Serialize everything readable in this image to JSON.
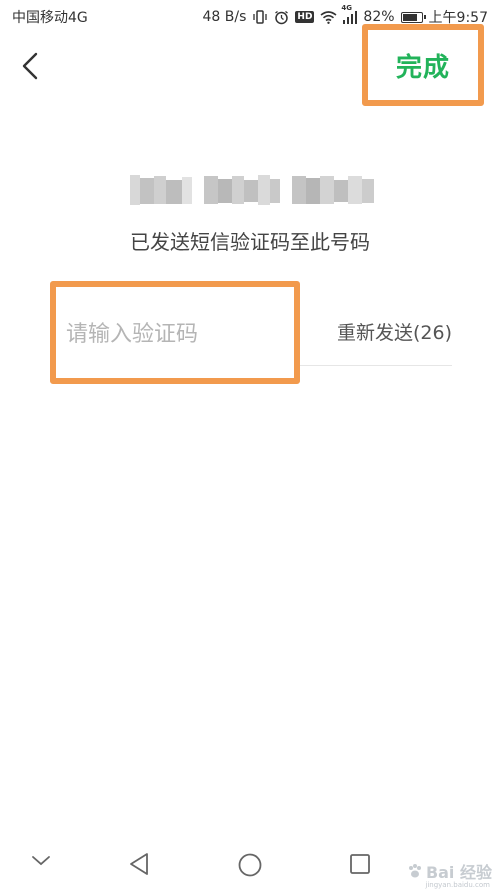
{
  "status_bar": {
    "carrier": "中国移动4G",
    "net_speed": "48 B/s",
    "battery_percent": "82%",
    "time": "上午9:57",
    "signal_label": "4G",
    "hd_label": "HD",
    "battery_level": 0.82,
    "icons": [
      "vibrate-icon",
      "alarm-icon",
      "hd-icon",
      "wifi-icon",
      "signal-icon",
      "battery-icon"
    ]
  },
  "header": {
    "back_icon": "chevron-left-icon",
    "done_label": "完成"
  },
  "verification": {
    "sent_hint": "已发送短信验证码至此号码",
    "code_placeholder": "请输入验证码",
    "code_value": "",
    "resend_label": "重新发送(26)"
  },
  "nav_bar": {
    "icons": [
      "chevron-down-icon",
      "back-triangle-icon",
      "home-circle-icon",
      "recents-square-icon"
    ]
  },
  "watermark": {
    "text": "Bai 经验",
    "sub": "jingyan.baidu.com"
  },
  "colors": {
    "accent_green": "#22b35a",
    "highlight_orange": "#f29a4d"
  }
}
